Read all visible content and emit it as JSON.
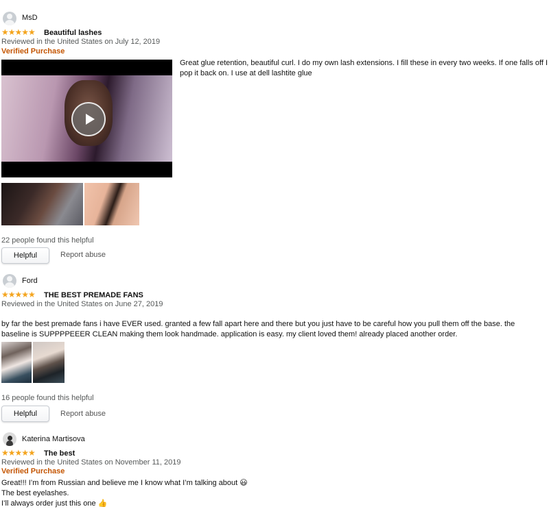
{
  "reviews": [
    {
      "name": "MsD",
      "stars": "★★★★★",
      "title": "Beautiful lashes",
      "meta": "Reviewed in the United States on July 12, 2019",
      "verified": "Verified Purchase",
      "body": "Great glue retention, beautiful curl. I do my own lash extensions. I fill these in every two weeks. If one falls off I pop it back on. I use at dell lashtite glue",
      "helpful_count": "22 people found this helpful",
      "helpful_btn": "Helpful",
      "report": "Report abuse"
    },
    {
      "name": "Ford",
      "stars": "★★★★★",
      "title": "THE BEST PREMADE FANS",
      "meta": "Reviewed in the United States on June 27, 2019",
      "body": "by far the best premade fans i have EVER used. granted a few fall apart here and there but you just have to be careful how you pull them off the base. the baseline is SUPPPPEEER CLEAN making them look handmade. application is easy. my client loved them! already placed another order.",
      "helpful_count": "16 people found this helpful",
      "helpful_btn": "Helpful",
      "report": "Report abuse"
    },
    {
      "name": "Katerina Martisova",
      "stars": "★★★★★",
      "title": "The best",
      "meta": "Reviewed in the United States on November 11, 2019",
      "verified": "Verified Purchase",
      "body_lines": [
        "Great!!! I’m from Russian and believe me I know what I’m talking about 😃",
        "The best eyelashes.",
        "I’ll always order just this one 👍"
      ]
    }
  ],
  "colors": {
    "star": "#f4a41d",
    "verified": "#c45500",
    "muted": "#565959"
  },
  "icons": {
    "avatar": "user-avatar-icon",
    "play": "play-icon",
    "star": "star-icon"
  }
}
